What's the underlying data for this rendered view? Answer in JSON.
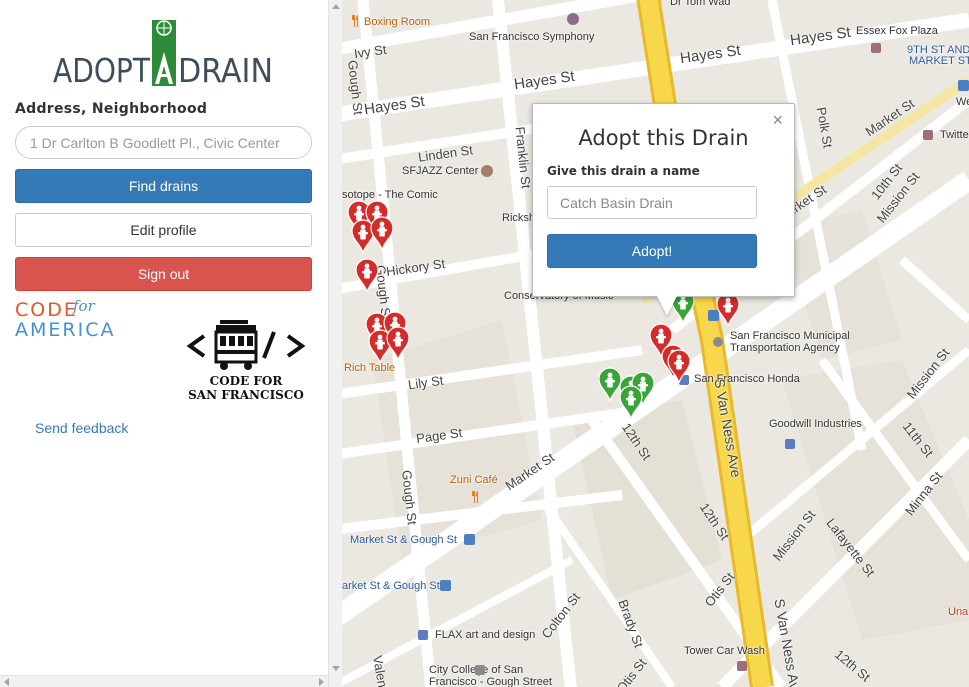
{
  "sidebar": {
    "logo_text": "ADOPTADRAIN",
    "address_label": "Address, Neighborhood",
    "address_placeholder": "1 Dr Carlton B Goodlett Pl., Civic Center",
    "find_label": "Find drains",
    "edit_label": "Edit profile",
    "signout_label": "Sign out",
    "cfa_code": "CODE",
    "cfa_for": "for",
    "cfa_america": "AMERICA",
    "cfsf_line1": "CODE FOR",
    "cfsf_line2": "SAN FRANCISCO",
    "feedback_label": "Send feedback"
  },
  "popup": {
    "title": "Adopt this Drain",
    "close": "×",
    "name_label": "Give this drain a name",
    "name_placeholder": "Catch Basin Drain",
    "adopt_label": "Adopt!"
  },
  "map": {
    "labels": {
      "boxing_room": "Boxing Room",
      "sf_symphony": "San Francisco Symphony",
      "dr_tom_wad": "Dr Tom Wad",
      "essex_fox": "Essex Fox Plaza",
      "ninth_market_1": "9TH ST AND",
      "ninth_market_2": "MARKET ST",
      "ivy_st": "Ivy St",
      "hayes_st_1": "Hayes St",
      "hayes_st_2": "Hayes St",
      "hayes_st_3": "Hayes St",
      "hayes_st_4": "Hayes St",
      "linden_st": "Linden St",
      "sfjazz": "SFJAZZ Center",
      "franklin_st": "Franklin St",
      "gough_st_1": "Gough St",
      "gough_st_2": "Gough St",
      "gough_st_3": "Gough St",
      "hickory_st": "Hickory St",
      "rickshaw": "Ricksh",
      "sotope": "sotope - The Comic",
      "conservatory": "Conservatory of Music",
      "sfmta_1": "San Francisco Municipal",
      "sfmta_2": "Transportation Agency",
      "sf_honda": "San Francisco Honda",
      "rich_table": "Rich Table",
      "lily_st": "Lily St",
      "page_st": "Page St",
      "goodwill": "Goodwill Industries",
      "zuni": "Zuni Café",
      "market_st_1": "Market St",
      "market_st_2": "Market St",
      "market_st_3": "Market St",
      "twelfth_st_1": "12th St",
      "twelfth_st_2": "12th St",
      "twelfth_st_3": "12th St",
      "s_van_ness_1": "S Van Ness Ave",
      "s_van_ness_2": "S Van Ness Ave",
      "mission_st_1": "Mission St",
      "mission_st_2": "Mission St",
      "mission_st_3": "Mission St",
      "market_gough_1": "Market St & Gough St",
      "market_gough_2": "arket St & Gough St",
      "otis_st_1": "Otis St",
      "otis_st_2": "Otis St",
      "colton_st": "Colton St",
      "brady_st": "Brady St",
      "flax": "FLAX art and design",
      "tower_car": "Tower Car Wash",
      "city_college_1": "City College of San",
      "city_college_2": "Francisco - Gough Street",
      "lafayette": "Lafayette St",
      "minna": "Minna St",
      "polk_st": "Polk St",
      "tenth_st": "10th St",
      "eleventh_st": "11th St",
      "market_st_ne": "Market St",
      "twitter": "Twitte",
      "una": "Una",
      "valencia": "Valen",
      "wel": "Welg"
    }
  }
}
